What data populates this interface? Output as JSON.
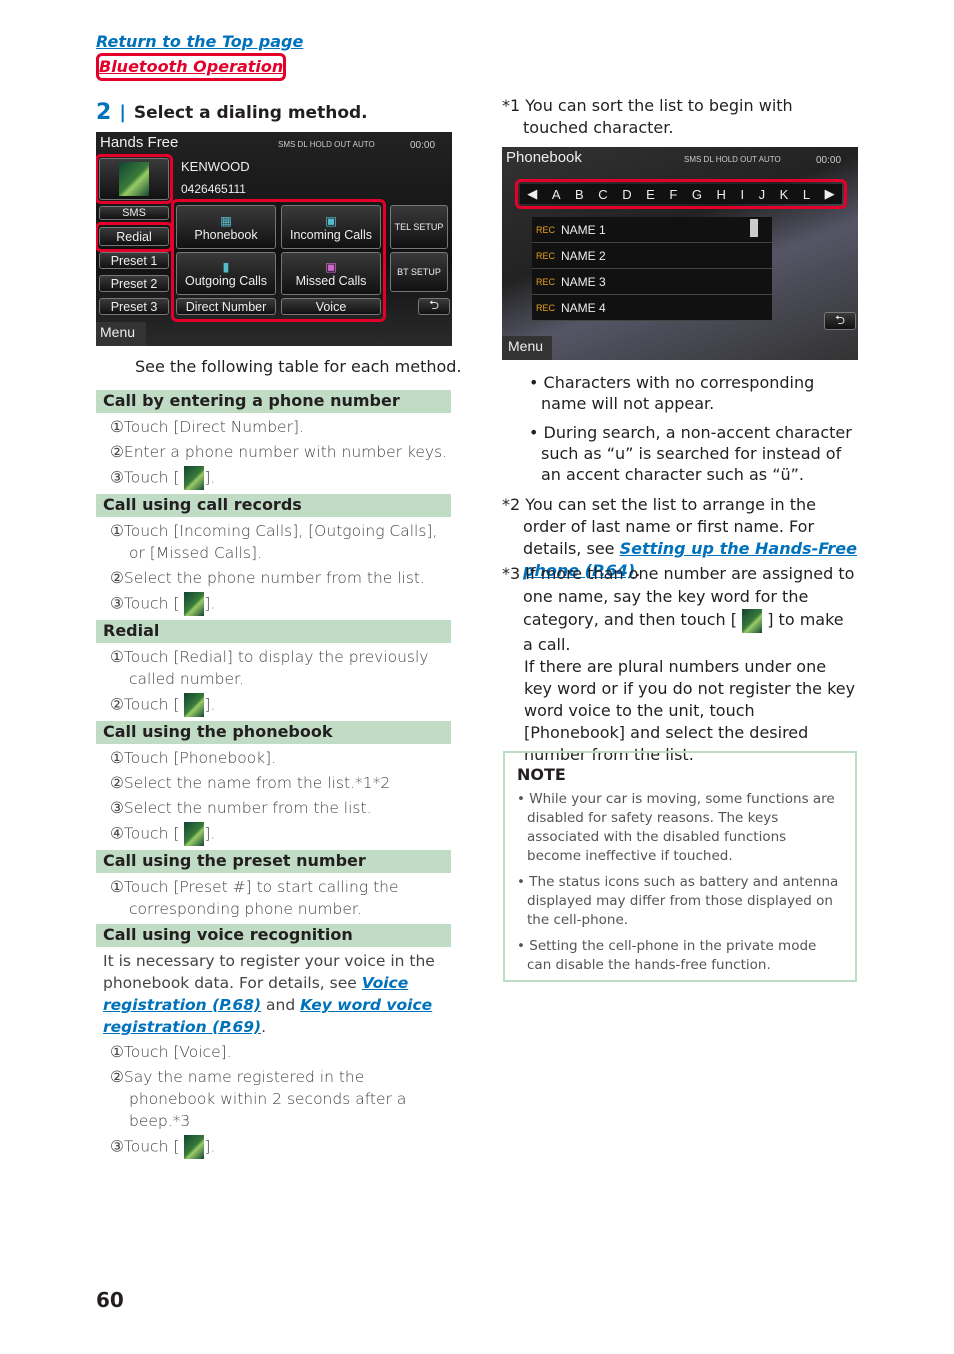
{
  "links": {
    "top": "Return to the Top page",
    "bt": "Bluetooth Operation"
  },
  "step": {
    "num": "2",
    "title": "Select a dialing method."
  },
  "screen1": {
    "title": "Hands Free",
    "status": "SMS DL HOLD OUT AUTO",
    "time": "00:00",
    "name": "KENWOOD",
    "number": "0426465111",
    "sms": "SMS",
    "redial": "Redial",
    "presets": [
      "Preset 1",
      "Preset 2",
      "Preset 3"
    ],
    "phonebook": "Phonebook",
    "incoming": "Incoming Calls",
    "outgoing": "Outgoing Calls",
    "missed": "Missed Calls",
    "direct": "Direct Number",
    "voice": "Voice",
    "tel_setup": "TEL SETUP",
    "bt_setup": "BT SETUP",
    "menu": "Menu"
  },
  "caption": "See the following table for each method.",
  "sections": [
    {
      "title": "Call by entering a phone number",
      "items": [
        {
          "n": "①",
          "t": "Touch [Direct Number]."
        },
        {
          "n": "②",
          "t": "Enter a phone number with number keys."
        },
        {
          "n": "③",
          "t": "Touch [",
          "icon": "phone-call",
          "a": "]."
        }
      ]
    },
    {
      "title": "Call using call records",
      "items": [
        {
          "n": "①",
          "t": "Touch [Incoming Calls], [Outgoing Calls], or [Missed Calls]."
        },
        {
          "n": "②",
          "t": "Select the phone number from the list."
        },
        {
          "n": "③",
          "t": "Touch [",
          "icon": "phone-call",
          "a": "]."
        }
      ]
    },
    {
      "title": "Redial",
      "items": [
        {
          "n": "①",
          "t": "Touch [Redial] to display the previously called number."
        },
        {
          "n": "②",
          "t": "Touch [",
          "icon": "phone-call",
          "a": "]."
        }
      ]
    },
    {
      "title": "Call using the phonebook",
      "items": [
        {
          "n": "①",
          "t": "Touch [Phonebook]."
        },
        {
          "n": "②",
          "t": "Select the name from the list.*1*2"
        },
        {
          "n": "③",
          "t": "Select the number from the list."
        },
        {
          "n": "④",
          "t": "Touch [",
          "icon": "phone-call",
          "a": "]."
        }
      ]
    },
    {
      "title": "Call using the preset number",
      "items": [
        {
          "n": "①",
          "t": "Touch [Preset #] to start calling the corresponding phone number."
        }
      ]
    },
    {
      "title": "Call using voice recognition",
      "intro": {
        "t1": "It is necessary to register your voice in the phonebook data. For details, see ",
        "l1": "Voice registration (P.68)",
        "t2": " and ",
        "l2": "Key word voice registration (P.69)",
        "t3": "."
      },
      "items": [
        {
          "n": "①",
          "t": "Touch [Voice]."
        },
        {
          "n": "②",
          "t": "Say the name registered in the phonebook within 2 seconds after a beep.*3"
        },
        {
          "n": "③",
          "t": "Touch [",
          "icon": "phone-call",
          "a": "]."
        }
      ]
    }
  ],
  "fn1": "*1 You can sort the list to begin with touched character.",
  "screen2": {
    "title": "Phonebook",
    "status": "SMS DL HOLD OUT AUTO",
    "time": "00:00",
    "letters": [
      "◀",
      "A",
      "B",
      "C",
      "D",
      "E",
      "F",
      "G",
      "H",
      "I",
      "J",
      "K",
      "L",
      "▶"
    ],
    "rec": "REC",
    "names": [
      "NAME 1",
      "NAME 2",
      "NAME 3",
      "NAME 4"
    ],
    "menu": "Menu"
  },
  "bullets": [
    "Characters with no corresponding name will not appear.",
    "During search, a non-accent character such as “u” is searched for instead of an accent character such as “ü”."
  ],
  "fn2": {
    "t": "*2 You can set the list to arrange in the order of last name or first name. For details, see ",
    "link": "Setting up the Hands-Free phone (P.64)",
    "a": "."
  },
  "fn3": {
    "t": "*3 If more than one number are assigned to one name, say the key word for the category, and then touch [",
    "a": "] to make a call.",
    "t2": "If there are plural numbers under one key word or if you do not register the key word voice to the unit, touch [Phonebook] and select the desired number from the list."
  },
  "note": {
    "title": "NOTE",
    "items": [
      "While your car is moving, some functions are disabled for safety reasons. The keys associated with the disabled functions become ineffective if touched.",
      "The status icons such as battery and antenna displayed may differ from those displayed on the cell-phone.",
      "Setting the cell-phone in the private mode can disable the hands-free function."
    ]
  },
  "page": "60"
}
